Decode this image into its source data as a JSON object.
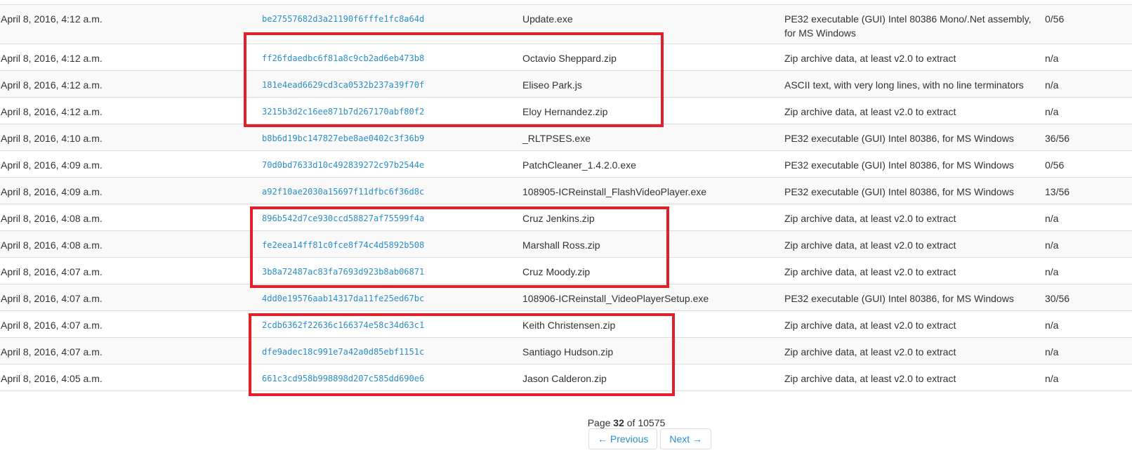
{
  "rows": [
    {
      "date": "April 8, 2016, 4:12 a.m.",
      "hash": "be27557682d3a21190f6fffe1fc8a64d",
      "name": "Update.exe",
      "type": "PE32 executable (GUI) Intel 80386 Mono/.Net assembly, for MS Windows",
      "detection": "0/56"
    },
    {
      "date": "April 8, 2016, 4:12 a.m.",
      "hash": "ff26fdaedbc6f81a8c9cb2ad6eb473b8",
      "name": "Octavio Sheppard.zip",
      "type": "Zip archive data, at least v2.0 to extract",
      "detection": "n/a"
    },
    {
      "date": "April 8, 2016, 4:12 a.m.",
      "hash": "181e4ead6629cd3ca0532b237a39f70f",
      "name": "Eliseo Park.js",
      "type": "ASCII text, with very long lines, with no line terminators",
      "detection": "n/a"
    },
    {
      "date": "April 8, 2016, 4:12 a.m.",
      "hash": "3215b3d2c16ee871b7d267170abf80f2",
      "name": "Eloy Hernandez.zip",
      "type": "Zip archive data, at least v2.0 to extract",
      "detection": "n/a"
    },
    {
      "date": "April 8, 2016, 4:10 a.m.",
      "hash": "b8b6d19bc147827ebe8ae0402c3f36b9",
      "name": "_RLTPSES.exe",
      "type": "PE32 executable (GUI) Intel 80386, for MS Windows",
      "detection": "36/56"
    },
    {
      "date": "April 8, 2016, 4:09 a.m.",
      "hash": "70d0bd7633d10c492839272c97b2544e",
      "name": "PatchCleaner_1.4.2.0.exe",
      "type": "PE32 executable (GUI) Intel 80386, for MS Windows",
      "detection": "0/56"
    },
    {
      "date": "April 8, 2016, 4:09 a.m.",
      "hash": "a92f10ae2030a15697f11dfbc6f36d8c",
      "name": "108905-ICReinstall_FlashVideoPlayer.exe",
      "type": "PE32 executable (GUI) Intel 80386, for MS Windows",
      "detection": "13/56"
    },
    {
      "date": "April 8, 2016, 4:08 a.m.",
      "hash": "896b542d7ce930ccd58827af75599f4a",
      "name": "Cruz Jenkins.zip",
      "type": "Zip archive data, at least v2.0 to extract",
      "detection": "n/a"
    },
    {
      "date": "April 8, 2016, 4:08 a.m.",
      "hash": "fe2eea14ff81c0fce8f74c4d5892b508",
      "name": "Marshall Ross.zip",
      "type": "Zip archive data, at least v2.0 to extract",
      "detection": "n/a"
    },
    {
      "date": "April 8, 2016, 4:07 a.m.",
      "hash": "3b8a72487ac83fa7693d923b8ab06871",
      "name": "Cruz Moody.zip",
      "type": "Zip archive data, at least v2.0 to extract",
      "detection": "n/a"
    },
    {
      "date": "April 8, 2016, 4:07 a.m.",
      "hash": "4dd0e19576aab14317da11fe25ed67bc",
      "name": "108906-ICReinstall_VideoPlayerSetup.exe",
      "type": "PE32 executable (GUI) Intel 80386, for MS Windows",
      "detection": "30/56"
    },
    {
      "date": "April 8, 2016, 4:07 a.m.",
      "hash": "2cdb6362f22636c166374e58c34d63c1",
      "name": "Keith Christensen.zip",
      "type": "Zip archive data, at least v2.0 to extract",
      "detection": "n/a"
    },
    {
      "date": "April 8, 2016, 4:07 a.m.",
      "hash": "dfe9adec18c991e7a42a0d85ebf1151c",
      "name": "Santiago Hudson.zip",
      "type": "Zip archive data, at least v2.0 to extract",
      "detection": "n/a"
    },
    {
      "date": "April 8, 2016, 4:05 a.m.",
      "hash": "661c3cd958b998898d207c585dd690e6",
      "name": "Jason Calderon.zip",
      "type": "Zip archive data, at least v2.0 to extract",
      "detection": "n/a"
    }
  ],
  "pagination": {
    "page_word": "Page",
    "current": "32",
    "of_word": "of",
    "total": "10575",
    "previous_label": "← Previous",
    "next_label": "Next →"
  },
  "colors": {
    "link": "#2a8fc7",
    "highlight_border": "#e3202a",
    "row_stripe": "#f9f9f9",
    "divider": "#dddddd"
  }
}
